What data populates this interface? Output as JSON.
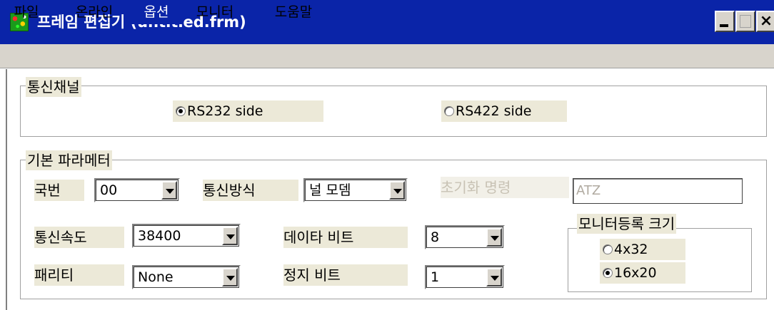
{
  "window": {
    "title": "프레임 편집기 (untitled.frm)",
    "title_bar_color": "#0a24a8",
    "controls": [
      "minimize",
      "maximize",
      "close"
    ],
    "close_glyph": "×"
  },
  "menu": {
    "items": [
      {
        "label": "파일"
      },
      {
        "label": "온라인"
      },
      {
        "label": "옵션",
        "active": true
      },
      {
        "label": "모니터"
      },
      {
        "label": "도움말"
      }
    ]
  },
  "comm_channel": {
    "group_label": "통신채널",
    "options": [
      {
        "label": "RS232 side",
        "checked": true
      },
      {
        "label": "RS422 side",
        "checked": false
      }
    ]
  },
  "basic_params": {
    "group_label": "기본 파라메터",
    "station": {
      "label": "국번",
      "value": "00"
    },
    "comm_method": {
      "label": "통신방식",
      "value": "널 모뎀"
    },
    "init_command": {
      "label": "초기화 명령",
      "value": "ATZ",
      "disabled": true
    },
    "baud_rate": {
      "label": "통신속도",
      "value": "38400"
    },
    "data_bits": {
      "label": "데이타 비트",
      "value": "8"
    },
    "parity": {
      "label": "패리티",
      "value": "None"
    },
    "stop_bits": {
      "label": "정지 비트",
      "value": "1"
    },
    "monitor_size": {
      "group_label": "모니터등록 크기",
      "options": [
        {
          "label": "4x32",
          "checked": false
        },
        {
          "label": "16x20",
          "checked": true
        }
      ]
    }
  }
}
